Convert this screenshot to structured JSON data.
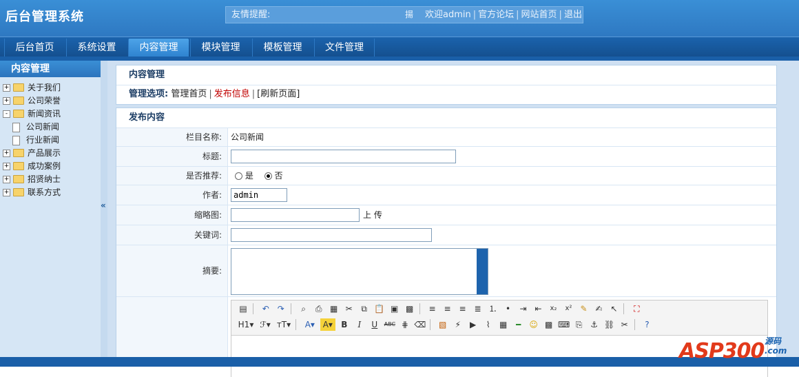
{
  "header": {
    "title": "后台管理系统",
    "tip_label": "友情提醒:",
    "top_icon": "揚",
    "welcome": "欢迎admin",
    "links": [
      "官方论坛",
      "网站首页",
      "退出"
    ]
  },
  "nav": {
    "tabs": [
      {
        "label": "后台首页"
      },
      {
        "label": "系统设置"
      },
      {
        "label": "内容管理",
        "active": true
      },
      {
        "label": "模块管理"
      },
      {
        "label": "模板管理"
      },
      {
        "label": "文件管理"
      }
    ]
  },
  "sidebar": {
    "title": "内容管理",
    "tree": [
      {
        "label": "关于我们",
        "type": "folder",
        "toggle": "+"
      },
      {
        "label": "公司荣誉",
        "type": "folder",
        "toggle": "+"
      },
      {
        "label": "新闻资讯",
        "type": "folder",
        "toggle": "-"
      },
      {
        "label": "公司新闻",
        "type": "doc"
      },
      {
        "label": "行业新闻",
        "type": "doc"
      },
      {
        "label": "产品展示",
        "type": "folder",
        "toggle": "+"
      },
      {
        "label": "成功案例",
        "type": "folder",
        "toggle": "+"
      },
      {
        "label": "招贤纳士",
        "type": "folder",
        "toggle": "+"
      },
      {
        "label": "联系方式",
        "type": "folder",
        "toggle": "+"
      }
    ],
    "collapse_arrow": "«"
  },
  "manage": {
    "title": "内容管理",
    "options_label": "管理选项:",
    "opt_home": "管理首页",
    "opt_publish": "发布信息",
    "opt_refresh": "[刷新页面]"
  },
  "form": {
    "title": "发布内容",
    "column_label": "栏目名称:",
    "column_value": "公司新闻",
    "title_label": "标题:",
    "title_value": "",
    "recommend_label": "是否推荐:",
    "recommend_yes": "是",
    "recommend_no": "否",
    "author_label": "作者:",
    "author_value": "admin",
    "thumb_label": "缩略图:",
    "thumb_value": "",
    "upload_label": "上 传",
    "keywords_label": "关键词:",
    "keywords_value": "",
    "summary_label": "摘要:"
  },
  "editor": {
    "heading_btn": "H1",
    "font_btn": "ℱ",
    "size_btn": "ᴛT"
  },
  "watermark": {
    "main": "ASP300",
    "side_top": "源码",
    "side_bottom": ".com"
  },
  "colors": {
    "header_blue": "#2f7ac3",
    "sidebar_bg": "#d6e6f5",
    "link_red": "#c00000"
  }
}
